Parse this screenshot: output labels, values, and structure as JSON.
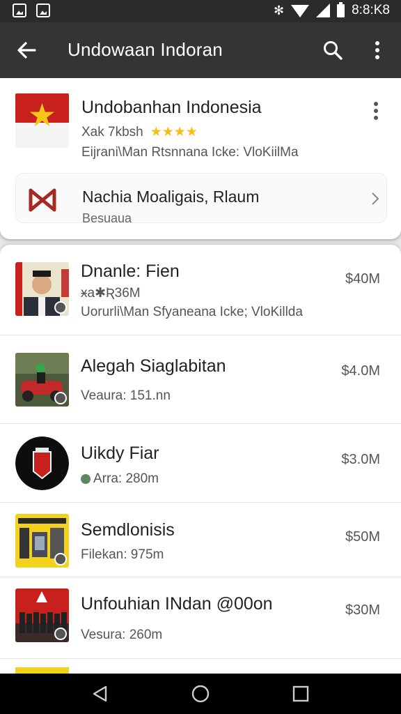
{
  "status_bar": {
    "time": "8:8:K8"
  },
  "toolbar": {
    "title": "Undowaan Indoran"
  },
  "top_card": {
    "title": "Undobanhan Indonesia",
    "rating_text": "Xak 7kbsh",
    "stars": "★★★★",
    "subtitle": "Eijrani\\Man Rtsnnana Icke: VloKiilMa",
    "promo": {
      "title": "Nachia Moaligais, Rlaum",
      "subtitle": "Besuaua"
    }
  },
  "items": [
    {
      "title": "Dnanle: Fien",
      "line1": "ӿa✱Ʀ36M",
      "line2": "Uorurli\\Man Sfyaneana Icke; VloKillda",
      "price": "$40M"
    },
    {
      "title": "Alegah Siaglabitan",
      "line1": "Veaura: 151.nn",
      "price": "$4.0M"
    },
    {
      "title": "Uikdy Fiar",
      "line1": "Arra: 280m",
      "price": "$3.0M"
    },
    {
      "title": "Semdlonisis",
      "line1": "Filekan: 975m",
      "price": "$50M"
    },
    {
      "title": "Unfouhian INdan  @00on",
      "line1": "Vesura: 260m",
      "price": "$30M"
    }
  ],
  "colors": {
    "toolbar": "#333436",
    "status_bar": "#2b2b2b",
    "star": "#f2c013",
    "flag_red": "#c8201c"
  }
}
